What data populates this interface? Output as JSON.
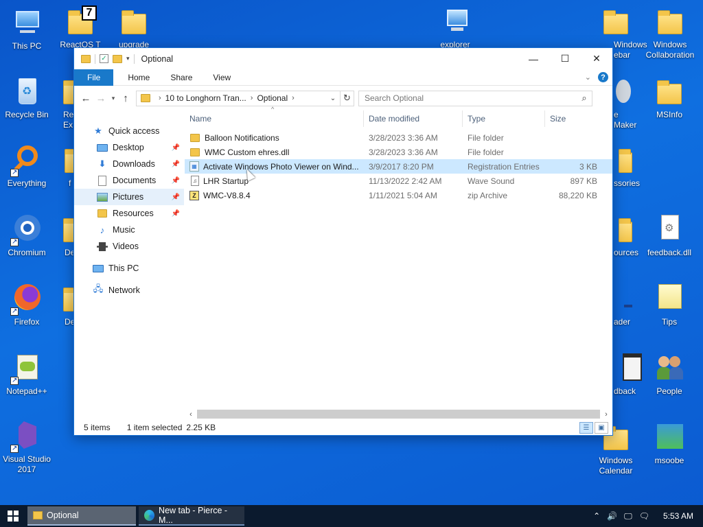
{
  "desktop": {
    "left_icons": [
      "This PC",
      "Recycle Bin",
      "Everything",
      "Chromium",
      "Firefox",
      "Notepad++",
      "Visual Studio 2017"
    ],
    "top_icons": [
      "ReactOS T",
      "upgrade",
      "explorer"
    ],
    "partial_left": [
      "Re Ex",
      "f",
      "De",
      "De"
    ],
    "right_col1": [
      "Windows ebar",
      "e Maker",
      "ssories",
      "ources",
      "ader",
      "dback",
      "Windows Calendar"
    ],
    "right_col2": [
      "Windows Collaboration",
      "MSInfo",
      "feedback.dll",
      "Tips",
      "People",
      "msoobe"
    ]
  },
  "window": {
    "title": "Optional",
    "controls": {
      "minimize": "—",
      "maximize": "☐",
      "close": "✕"
    },
    "ribbon": {
      "file": "File",
      "home": "Home",
      "share": "Share",
      "view": "View"
    },
    "address": {
      "part1": "10 to Longhorn Tran...",
      "part2": "Optional"
    },
    "search_placeholder": "Search Optional",
    "nav": {
      "quick_access": "Quick access",
      "items": [
        "Desktop",
        "Downloads",
        "Documents",
        "Pictures",
        "Resources",
        "Music",
        "Videos"
      ],
      "this_pc": "This PC",
      "network": "Network"
    },
    "columns": {
      "name": "Name",
      "date": "Date modified",
      "type": "Type",
      "size": "Size"
    },
    "files": [
      {
        "name": "Balloon Notifications",
        "date": "3/28/2023 3:36 AM",
        "type": "File folder",
        "size": ""
      },
      {
        "name": "WMC Custom ehres.dll",
        "date": "3/28/2023 3:36 AM",
        "type": "File folder",
        "size": ""
      },
      {
        "name": "Activate Windows Photo Viewer on Wind...",
        "date": "3/9/2017 8:20 PM",
        "type": "Registration Entries",
        "size": "3 KB"
      },
      {
        "name": "LHR Startup",
        "date": "11/13/2022 2:42 AM",
        "type": "Wave Sound",
        "size": "897 KB"
      },
      {
        "name": "WMC-V8.8.4",
        "date": "1/11/2021 5:04 AM",
        "type": "zip Archive",
        "size": "88,220 KB"
      }
    ],
    "status": {
      "count": "5 items",
      "selected": "1 item selected",
      "size": "2.25 KB"
    }
  },
  "taskbar": {
    "items": [
      "Optional",
      "New tab - Pierce - M..."
    ],
    "clock": "5:53 AM"
  },
  "colors": {
    "accent": "#1979ca",
    "selection": "#cce8ff",
    "desktop": "#0f6fe0",
    "taskbar": "#0b1a2e"
  }
}
